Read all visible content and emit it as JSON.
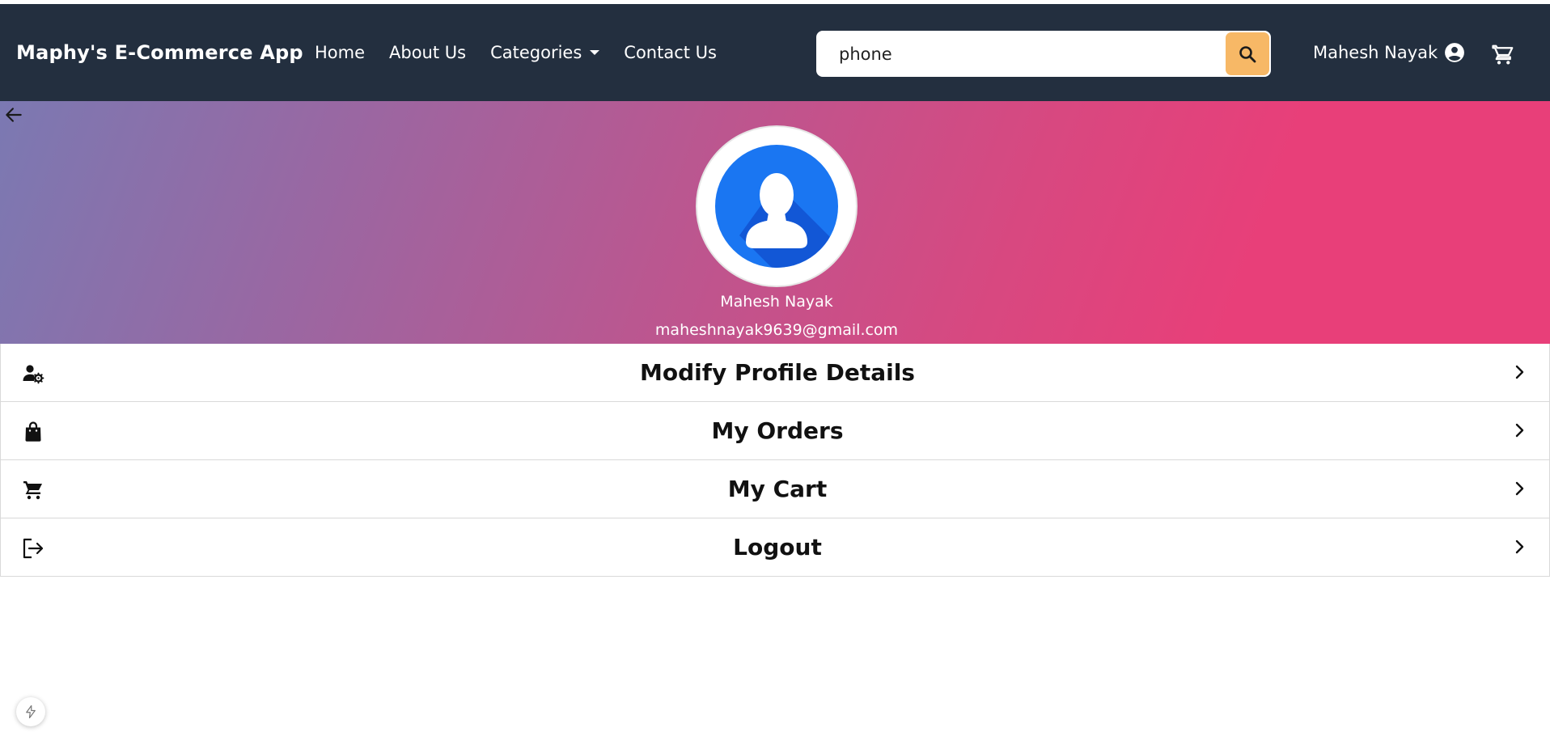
{
  "navbar": {
    "brand": "Maphy's E-Commerce App",
    "links": [
      {
        "label": "Home"
      },
      {
        "label": "About Us"
      },
      {
        "label": "Categories"
      },
      {
        "label": "Contact Us"
      }
    ],
    "search": {
      "value": "phone",
      "icon": "search-icon"
    },
    "user_name": "Mahesh Nayak",
    "user_icon": "account-circle-icon",
    "cart_icon": "cart-icon"
  },
  "colors": {
    "navbar_bg": "#232f3f",
    "search_button": "#f7b866",
    "gradient_start": "#7b79b2",
    "gradient_end": "#e83f79",
    "avatar_blue": "#1a76f2"
  },
  "profile": {
    "name": "Mahesh Nayak",
    "email": "maheshnayak9639@gmail.com",
    "avatar_icon": "user-avatar-icon",
    "back_icon": "arrow-left-icon"
  },
  "menu": [
    {
      "label": "Modify Profile Details",
      "icon": "manage-account-icon"
    },
    {
      "label": "My Orders",
      "icon": "shopping-bag-icon"
    },
    {
      "label": "My Cart",
      "icon": "cart-icon"
    },
    {
      "label": "Logout",
      "icon": "logout-icon"
    }
  ]
}
